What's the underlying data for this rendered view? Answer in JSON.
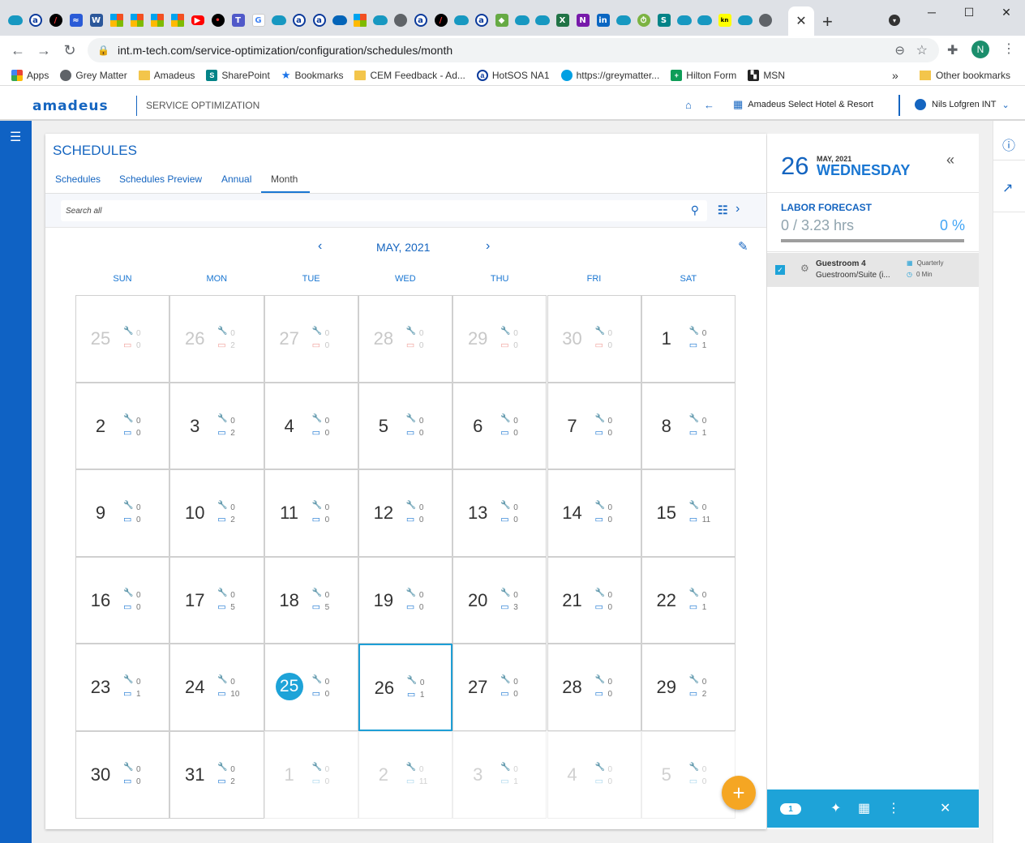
{
  "browser": {
    "url": "int.m-tech.com/service-optimization/configuration/schedules/month",
    "bookmarks": [
      "Apps",
      "Grey Matter",
      "Amadeus",
      "SharePoint",
      "Bookmarks",
      "CEM Feedback - Ad...",
      "HotSOS NA1",
      "https://greymatter...",
      "Hilton Form",
      "MSN"
    ],
    "other_bookmarks": "Other bookmarks",
    "profile_initial": "N"
  },
  "app": {
    "logo": "amadeus",
    "title": "SERVICE OPTIMIZATION",
    "hotel": "Amadeus Select Hotel & Resort",
    "user": "Nils Lofgren INT"
  },
  "page": {
    "title": "SCHEDULES",
    "tabs": [
      "Schedules",
      "Schedules Preview",
      "Annual",
      "Month"
    ],
    "active_tab": "Month",
    "search_placeholder": "Search all",
    "month_label": "MAY, 2021",
    "weekdays": [
      "SUN",
      "MON",
      "TUE",
      "WED",
      "THU",
      "FRI",
      "SAT"
    ]
  },
  "calendar": {
    "weeks": [
      [
        {
          "d": "25",
          "a": "0",
          "b": "0",
          "t": "prev"
        },
        {
          "d": "26",
          "a": "0",
          "b": "2",
          "t": "prev"
        },
        {
          "d": "27",
          "a": "0",
          "b": "0",
          "t": "prev"
        },
        {
          "d": "28",
          "a": "0",
          "b": "0",
          "t": "prev"
        },
        {
          "d": "29",
          "a": "0",
          "b": "0",
          "t": "prev"
        },
        {
          "d": "30",
          "a": "0",
          "b": "0",
          "t": "prev"
        },
        {
          "d": "1",
          "a": "0",
          "b": "1",
          "t": "cur"
        }
      ],
      [
        {
          "d": "2",
          "a": "0",
          "b": "0",
          "t": "cur"
        },
        {
          "d": "3",
          "a": "0",
          "b": "2",
          "t": "cur"
        },
        {
          "d": "4",
          "a": "0",
          "b": "0",
          "t": "cur"
        },
        {
          "d": "5",
          "a": "0",
          "b": "0",
          "t": "cur"
        },
        {
          "d": "6",
          "a": "0",
          "b": "0",
          "t": "cur"
        },
        {
          "d": "7",
          "a": "0",
          "b": "0",
          "t": "cur"
        },
        {
          "d": "8",
          "a": "0",
          "b": "1",
          "t": "cur"
        }
      ],
      [
        {
          "d": "9",
          "a": "0",
          "b": "0",
          "t": "cur"
        },
        {
          "d": "10",
          "a": "0",
          "b": "2",
          "t": "cur"
        },
        {
          "d": "11",
          "a": "0",
          "b": "0",
          "t": "cur"
        },
        {
          "d": "12",
          "a": "0",
          "b": "0",
          "t": "cur"
        },
        {
          "d": "13",
          "a": "0",
          "b": "0",
          "t": "cur"
        },
        {
          "d": "14",
          "a": "0",
          "b": "0",
          "t": "cur"
        },
        {
          "d": "15",
          "a": "0",
          "b": "11",
          "t": "cur"
        }
      ],
      [
        {
          "d": "16",
          "a": "0",
          "b": "0",
          "t": "cur"
        },
        {
          "d": "17",
          "a": "0",
          "b": "5",
          "t": "cur"
        },
        {
          "d": "18",
          "a": "0",
          "b": "5",
          "t": "cur"
        },
        {
          "d": "19",
          "a": "0",
          "b": "0",
          "t": "cur"
        },
        {
          "d": "20",
          "a": "0",
          "b": "3",
          "t": "cur"
        },
        {
          "d": "21",
          "a": "0",
          "b": "0",
          "t": "cur"
        },
        {
          "d": "22",
          "a": "0",
          "b": "1",
          "t": "cur"
        }
      ],
      [
        {
          "d": "23",
          "a": "0",
          "b": "1",
          "t": "cur"
        },
        {
          "d": "24",
          "a": "0",
          "b": "10",
          "t": "cur"
        },
        {
          "d": "25",
          "a": "0",
          "b": "0",
          "t": "today"
        },
        {
          "d": "26",
          "a": "0",
          "b": "1",
          "t": "sel"
        },
        {
          "d": "27",
          "a": "0",
          "b": "0",
          "t": "cur"
        },
        {
          "d": "28",
          "a": "0",
          "b": "0",
          "t": "cur"
        },
        {
          "d": "29",
          "a": "0",
          "b": "2",
          "t": "cur"
        }
      ],
      [
        {
          "d": "30",
          "a": "0",
          "b": "0",
          "t": "cur"
        },
        {
          "d": "31",
          "a": "0",
          "b": "2",
          "t": "cur"
        },
        {
          "d": "1",
          "a": "0",
          "b": "0",
          "t": "next"
        },
        {
          "d": "2",
          "a": "0",
          "b": "11",
          "t": "next"
        },
        {
          "d": "3",
          "a": "0",
          "b": "1",
          "t": "next"
        },
        {
          "d": "4",
          "a": "0",
          "b": "0",
          "t": "next"
        },
        {
          "d": "5",
          "a": "0",
          "b": "0",
          "t": "next"
        }
      ]
    ]
  },
  "detail": {
    "day": "26",
    "month_year": "MAY, 2021",
    "weekday": "WEDNESDAY",
    "labor_title": "LABOR FORECAST",
    "labor_value": "0 / 3.23 hrs",
    "labor_pct": "0 %",
    "item": {
      "name": "Guestroom 4",
      "sub": "Guestroom/Suite (i...",
      "frequency": "Quarterly",
      "duration": "0 Min"
    },
    "selected_count": "1"
  },
  "colors": {
    "brand": "#1565c0",
    "accent": "#1ea3d8",
    "fab": "#f5a623"
  }
}
